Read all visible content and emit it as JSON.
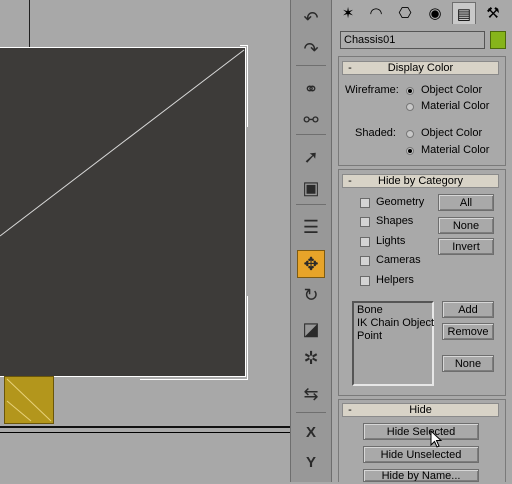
{
  "toolbar": {
    "buttons": [
      {
        "name": "undo-icon",
        "glyph": "↶"
      },
      {
        "name": "redo-icon",
        "glyph": "↷"
      },
      {
        "name": "select-and-link-icon",
        "glyph": "⚭"
      },
      {
        "name": "unlink-selection-icon",
        "glyph": "⚯"
      },
      {
        "name": "select-object-icon",
        "glyph": "➚"
      },
      {
        "name": "select-region-icon",
        "glyph": "▣"
      },
      {
        "name": "select-by-name-icon",
        "glyph": "☰"
      },
      {
        "name": "select-and-move-icon",
        "glyph": "✥"
      },
      {
        "name": "select-and-rotate-icon",
        "glyph": "↻"
      },
      {
        "name": "select-and-scale-icon",
        "glyph": "◪"
      },
      {
        "name": "select-manipulate-icon",
        "glyph": "✲"
      },
      {
        "name": "mirror-icon",
        "glyph": "⇆"
      },
      {
        "name": "x-axis-icon",
        "glyph": "X"
      },
      {
        "name": "y-axis-icon",
        "glyph": "Y"
      }
    ]
  },
  "tabs": [
    {
      "name": "create-tab-icon",
      "glyph": "✶"
    },
    {
      "name": "modify-tab-icon",
      "glyph": "◠"
    },
    {
      "name": "hierarchy-tab-icon",
      "glyph": "⎔"
    },
    {
      "name": "motion-tab-icon",
      "glyph": "◉"
    },
    {
      "name": "display-tab-icon",
      "glyph": "▤"
    },
    {
      "name": "utilities-tab-icon",
      "glyph": "⚒"
    }
  ],
  "object_name": "Chassis01",
  "object_color": "#86b41a",
  "display_color": {
    "collapse": "-",
    "title": "Display Color",
    "wireframe_label": "Wireframe:",
    "shaded_label": "Shaded:",
    "object_color": "Object Color",
    "material_color": "Material Color"
  },
  "hide_by_category": {
    "collapse": "-",
    "title": "Hide by Category",
    "categories": [
      "Geometry",
      "Shapes",
      "Lights",
      "Cameras",
      "Helpers"
    ],
    "all_label": "All",
    "none_label": "None",
    "invert_label": "Invert",
    "list_items": [
      "Bone",
      "IK Chain Object",
      "Point"
    ],
    "add_label": "Add",
    "remove_label": "Remove",
    "none2_label": "None"
  },
  "hide": {
    "collapse": "-",
    "title": "Hide",
    "hide_selected": "Hide Selected",
    "hide_unselected": "Hide Unselected",
    "hide_by_name": "Hide by Name..."
  }
}
